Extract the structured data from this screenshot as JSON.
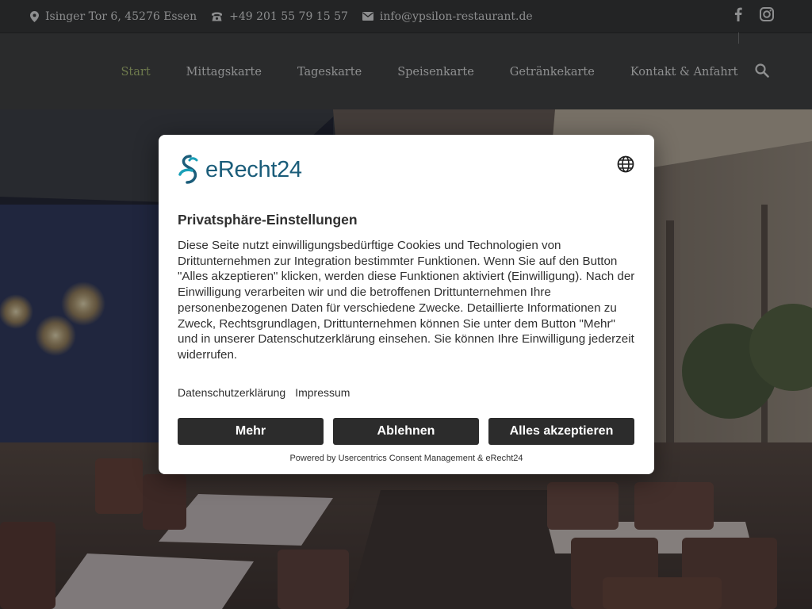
{
  "topbar": {
    "address": "Isinger Tor 6, 45276 Essen",
    "phone": "+49 201 55 79 15 57",
    "email": "info@ypsilon-restaurant.de",
    "address_icon": "map-pin-icon",
    "phone_icon": "phone-icon",
    "email_icon": "envelope-icon",
    "social": [
      "facebook-icon",
      "instagram-icon"
    ]
  },
  "nav": {
    "items": [
      "Start",
      "Mittagskarte",
      "Tageskarte",
      "Speisenkarte",
      "Getränkekarte",
      "Kontakt & Anfahrt"
    ],
    "active": "Start",
    "active_color": "#6e7a4d",
    "search_icon": "search-icon"
  },
  "consent": {
    "logo_text": "eRecht24",
    "language_icon": "globe-icon",
    "title": "Privatsphäre-Einstellungen",
    "description": "Diese Seite nutzt einwilligungsbedürftige Cookies und Technologien von Drittunternehmen zur Integration bestimmter Funktionen. Wenn Sie auf den Button \"Alles akzeptieren\" klicken, werden diese Funktionen aktiviert (Einwilligung). Nach der Einwilligung verarbeiten wir und die betroffenen Drittunternehmen Ihre personenbezogenen Daten für verschiedene Zwecke. Detaillierte Informationen zu Zweck, Rechtsgrundlagen, Drittunternehmen können Sie unter dem Button \"Mehr\" und in unserer Datenschutzerklärung einsehen. Sie können Ihre Einwilligung jederzeit widerrufen.",
    "links": [
      "Datenschutzerklärung",
      "Impressum"
    ],
    "buttons": {
      "more": "Mehr",
      "decline": "Ablehnen",
      "accept_all": "Alles akzeptieren"
    },
    "powered_by": "Powered by Usercentrics Consent Management & eRecht24",
    "button_color": "#2c2c2c",
    "brand_color": "#1b5d7a"
  }
}
